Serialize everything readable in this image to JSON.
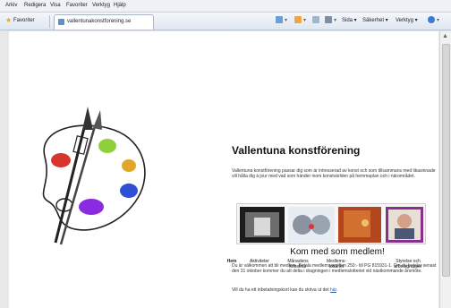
{
  "menu": [
    "Arkiv",
    "Redigera",
    "Visa",
    "Favoriter",
    "Verktyg",
    "Hjälp"
  ],
  "favorites": {
    "label": "Favoriter",
    "tab_title": "vallentunakonstforening.se"
  },
  "commandbar": {
    "page": "Sida",
    "safety": "Säkerhet",
    "tools": "Verktyg"
  },
  "site": {
    "title": "Vallentuna konstförening",
    "intro": "Vallentuna konstförening passar dig som är intresserad av konst och som tillsammans med likasinnade vill hålla dig à jour med vad som händer inom konstvärlden på hemmaplan och i närområdet.",
    "nav": [
      "Hem",
      "Aktiviteter",
      "Månadens konstnär",
      "Medlems-lotteriet",
      "Styrelse och arbetsgrupper"
    ],
    "heading": "Kom med som medlem!",
    "paragraph1": "Du är välkommen att bli medlem. Betala medlemsavgiften 250:- till PG 815931-1. Om du betalar senast den 31 oktober kommer du att delta i dragningen i medlemslotteriet vid nästkommande årsmöte.",
    "paragraph2_text": "Vill du ha ett inbetalningskort kan du skriva ut det",
    "paragraph2_link": "här"
  },
  "colors": {
    "palette_red": "#d8352e",
    "palette_green": "#8fcf3a",
    "palette_purple": "#8a2be2",
    "palette_blue": "#2e4fd6",
    "palette_gold": "#e0a72a"
  }
}
